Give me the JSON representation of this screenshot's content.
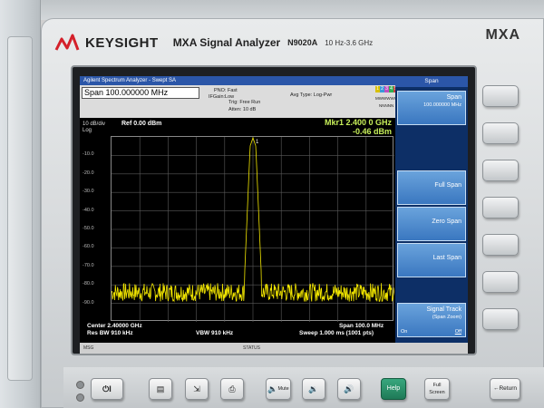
{
  "instrument": {
    "brand": "KEYSIGHT",
    "model": "MXA Signal Analyzer",
    "model_number": "N9020A",
    "freq_range": "10 Hz-3.6 GHz",
    "badge": "MXA"
  },
  "screen": {
    "title": "Agilent Spectrum Analyzer - Swept SA",
    "span_field": "Span 100.000000 MHz",
    "pno": "PNO: Fast",
    "ifgain": "IFGain:Low",
    "trig": "Trig: Free Run",
    "atten": "Atten: 10 dB",
    "avg_type": "Avg Type: Log-Pwr",
    "trace_nums": [
      "1",
      "2",
      "3",
      "4",
      "5",
      "6"
    ],
    "trace_type": "MWWWWW",
    "det_row": "NNNNN",
    "marker_line1": "Mkr1 2.400 0 GHz",
    "marker_line2": "-0.46 dBm",
    "scale": "10 dB/div",
    "scale_type": "Log",
    "ref_level": "Ref 0.00 dBm",
    "marker_label": "1",
    "center": "Center 2.40000 GHz",
    "res_bw": "Res BW 910 kHz",
    "vbw": "VBW 910 kHz",
    "span_bottom": "Span 100.0 MHz",
    "sweep": "Sweep  1.000 ms (1001 pts)",
    "status_left": "MSG",
    "status_center": "STATUS"
  },
  "menu": {
    "title": "Span",
    "keys": [
      {
        "label": "Span",
        "sub": "100.000000 MHz"
      },
      {
        "label": "Full Span",
        "sub": ""
      },
      {
        "label": "Zero Span",
        "sub": ""
      },
      {
        "label": "Last Span",
        "sub": ""
      },
      {
        "label": "Signal Track",
        "sub": "(Span Zoom)",
        "state_on": "On",
        "state_off": "Off"
      }
    ]
  },
  "hard_keys": {
    "power": "I",
    "mute": "Mute",
    "help": "Help",
    "full_screen_line1": "Full",
    "full_screen_line2": "Screen",
    "return": "Return"
  },
  "chart_data": {
    "type": "line",
    "title": "",
    "xlabel": "",
    "ylabel": "",
    "ylim": [
      -100,
      0
    ],
    "y_ticks": [
      "-10.0",
      "-20.0",
      "-30.0",
      "-40.0",
      "-50.0",
      "-60.0",
      "-70.0",
      "-80.0",
      "-90.0"
    ],
    "x_range_ghz": [
      2.35,
      2.45
    ],
    "series": [
      {
        "color": "#f2e600",
        "x": [
          2.35,
          2.36,
          2.37,
          2.38,
          2.39,
          2.397,
          2.399,
          2.4,
          2.401,
          2.403,
          2.41,
          2.42,
          2.43,
          2.44,
          2.45
        ],
        "values": [
          -84,
          -83,
          -84,
          -85,
          -84,
          -76,
          -5,
          -0.46,
          -5,
          -76,
          -84,
          -83,
          -84,
          -85,
          -84
        ]
      }
    ],
    "noise_floor_dbm": -84,
    "noise_spread_db": 10,
    "grid": true
  }
}
